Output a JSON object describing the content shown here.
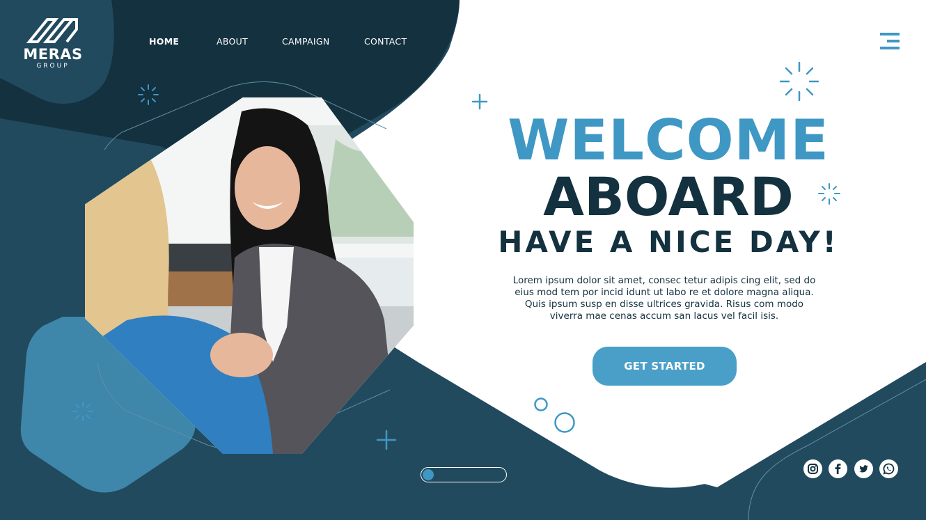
{
  "brand": {
    "name": "MERAS",
    "subtitle": "GROUP"
  },
  "nav": {
    "items": [
      {
        "label": "HOME",
        "active": true
      },
      {
        "label": "ABOUT",
        "active": false
      },
      {
        "label": "CAMPAIGN",
        "active": false
      },
      {
        "label": "CONTACT",
        "active": false
      }
    ]
  },
  "hero": {
    "title_line1": "WELCOME",
    "title_line2": "ABOARD",
    "title_line3": "HAVE A NICE DAY!",
    "description": "Lorem ipsum dolor sit amet, consec tetur adipis cing elit, sed do eius mod tem por incid idunt ut labo re et dolore magna aliqua. Quis ipsum susp en disse ultrices gravida. Risus com modo viverra mae cenas accum san lacus vel facil isis.",
    "cta_label": "GET STARTED"
  },
  "social": [
    "instagram-icon",
    "facebook-icon",
    "twitter-icon",
    "whatsapp-icon"
  ],
  "colors": {
    "navy": "#14313f",
    "dark_teal": "#224a5e",
    "accent_blue": "#3f97c4",
    "white": "#ffffff"
  }
}
